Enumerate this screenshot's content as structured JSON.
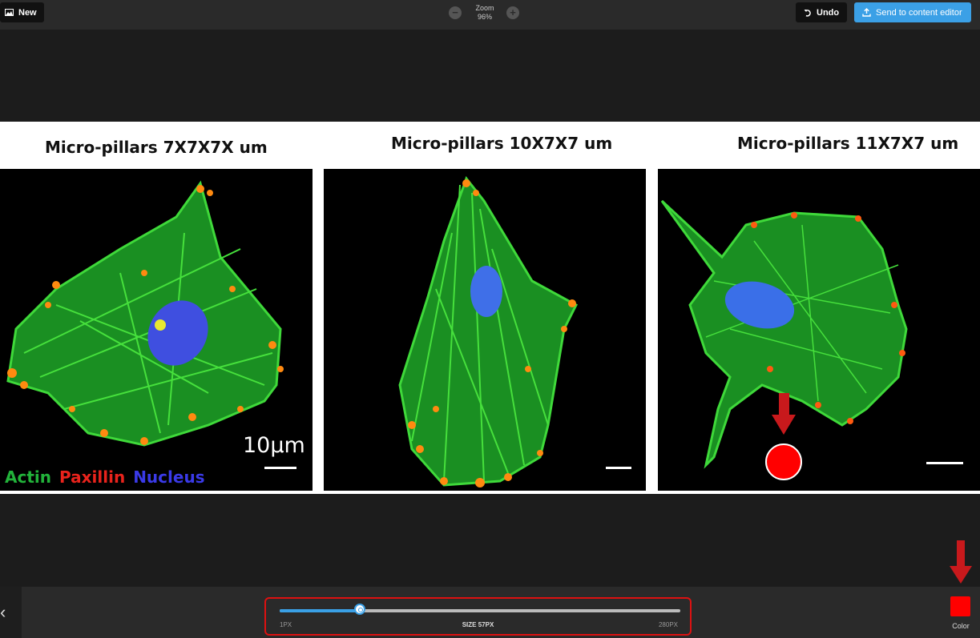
{
  "toolbar": {
    "new_label": "New",
    "zoom_title": "Zoom",
    "zoom_value": "96%",
    "zoom_minus": "−",
    "zoom_plus": "+",
    "undo_label": "Undo",
    "send_label": "Send to content editor"
  },
  "figure": {
    "panels": [
      {
        "title": "Micro-pillars 7X7X7X um"
      },
      {
        "title": "Micro-pillars 10X7X7 um"
      },
      {
        "title": "Micro-pillars 11X7X7 um"
      }
    ],
    "scale_label": "10μm",
    "legend": {
      "actin": "Actin",
      "paxillin": "Paxillin",
      "nucleus": "Nucleus",
      "colors": {
        "actin": "#22b33a",
        "paxillin": "#e8231c",
        "nucleus": "#3a3ae8"
      }
    }
  },
  "brush": {
    "min_label": "1PX",
    "max_label": "280PX",
    "size_label": "SIZE 57PX",
    "size_fraction": 0.2,
    "color_label": "Color",
    "color": "#ff0000"
  },
  "icons": {
    "new": "image-icon",
    "undo": "undo-icon",
    "send": "upload-icon",
    "collapse": "chevron-left-icon"
  }
}
